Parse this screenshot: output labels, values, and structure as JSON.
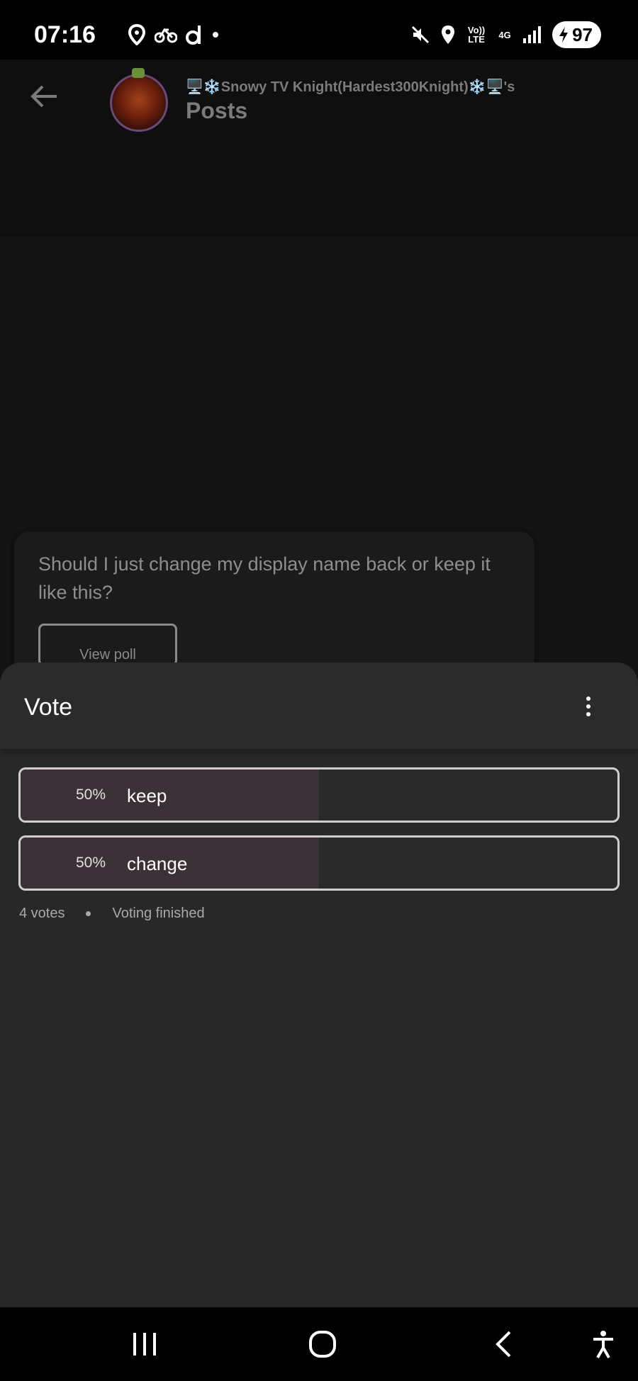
{
  "status_bar": {
    "time": "07:16",
    "left_icons": [
      "location-pin-icon",
      "bike-icon",
      "d-app-icon",
      "dot-icon"
    ],
    "right_icons": [
      "mute-icon",
      "location-icon",
      "volte-icon",
      "4g-icon",
      "signal-icon"
    ],
    "net_volte": "Vo)) LTE",
    "net_4g": "4G",
    "battery": "97"
  },
  "header": {
    "owner": "🖥️❄️Snowy TV Knight(Hardest300Knight)❄️🖥️'s",
    "title": "Posts"
  },
  "post": {
    "question": "Should I just change my display name back or keep it like this?",
    "view_poll_label": "View poll"
  },
  "sheet": {
    "title": "Vote",
    "options": [
      {
        "percent_label": "50%",
        "label": "keep",
        "fraction": 0.5
      },
      {
        "percent_label": "50%",
        "label": "change",
        "fraction": 0.5
      }
    ],
    "votes": "4 votes",
    "status": "Voting finished"
  },
  "colors": {
    "sheet_bg": "#282828",
    "option_fill": "#3d3138",
    "option_border": "#cfcfcf"
  }
}
